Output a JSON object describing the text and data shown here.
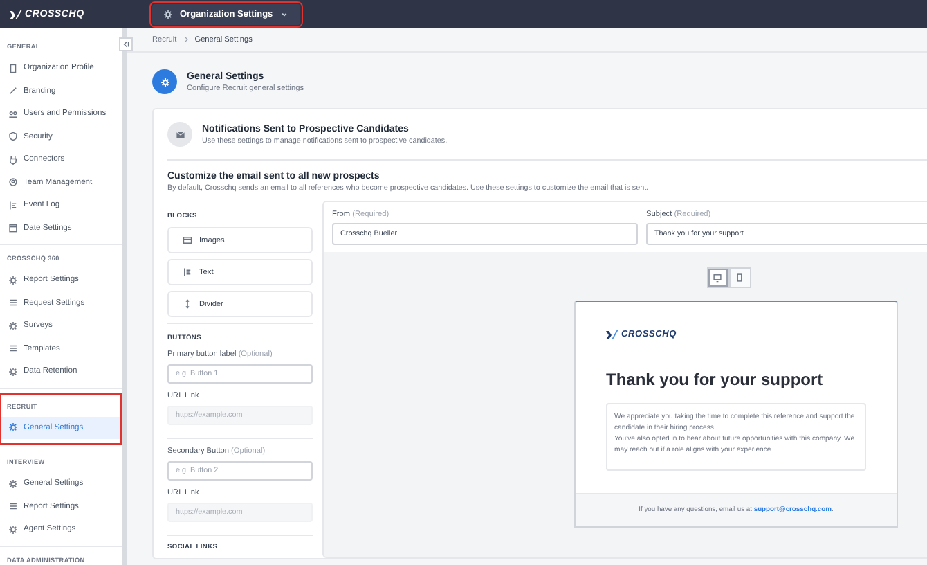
{
  "topbar": {
    "logo": "CROSSCHQ",
    "menu": {
      "label": "Organization Settings",
      "highlighted": true
    }
  },
  "sidebar": {
    "sections": [
      {
        "title": "GENERAL",
        "highlighted": false,
        "items": [
          {
            "label": "Organization Profile",
            "selected": false
          },
          {
            "label": "Branding",
            "selected": false
          },
          {
            "label": "Users and Permissions",
            "selected": false
          },
          {
            "label": "Security",
            "selected": false
          },
          {
            "label": "Connectors",
            "selected": false
          },
          {
            "label": "Team Management",
            "selected": false
          },
          {
            "label": "Event Log",
            "selected": false
          },
          {
            "label": "Date Settings",
            "selected": false
          }
        ]
      },
      {
        "title": "CROSSCHQ 360",
        "highlighted": false,
        "items": [
          {
            "label": "Report Settings",
            "selected": false
          },
          {
            "label": "Request Settings",
            "selected": false
          },
          {
            "label": "Surveys",
            "selected": false
          },
          {
            "label": "Templates",
            "selected": false
          },
          {
            "label": "Data Retention",
            "selected": false
          }
        ]
      },
      {
        "title": "RECRUIT",
        "highlighted": true,
        "items": [
          {
            "label": "General Settings",
            "selected": true
          }
        ]
      },
      {
        "title": "INTERVIEW",
        "highlighted": false,
        "items": [
          {
            "label": "General Settings",
            "selected": false
          },
          {
            "label": "Report Settings",
            "selected": false
          },
          {
            "label": "Agent Settings",
            "selected": false
          }
        ]
      },
      {
        "title": "DATA ADMINISTRATION",
        "highlighted": false
      }
    ]
  },
  "breadcrumb": [
    "Recruit",
    "General Settings"
  ],
  "page_header": {
    "title": "General Settings",
    "subtitle": "Configure Recruit general settings"
  },
  "notification": {
    "title": "Notifications Sent to Prospective Candidates",
    "description": "Use these settings to manage notifications sent to prospective candidates."
  },
  "customize": {
    "title": "Customize the email sent to all new prospects",
    "description": "By default, Crosschq sends an email to all references who become prospective candidates. Use these settings to customize the email that is sent."
  },
  "blocks": {
    "heading": "BLOCKS",
    "items": [
      "Images",
      "Text",
      "Divider"
    ]
  },
  "buttons_section": {
    "heading": "BUTTONS",
    "fields": [
      {
        "label": "Primary button label",
        "hint": "(Optional)",
        "placeholder": "e.g. Button 1",
        "disabled": false
      },
      {
        "label": "URL Link",
        "placeholder": "https://example.com",
        "disabled": true
      },
      {
        "label": "Secondary Button",
        "hint": "(Optional)",
        "placeholder": "e.g. Button 2",
        "disabled": false
      },
      {
        "label": "URL Link",
        "placeholder": "https://example.com",
        "disabled": true
      }
    ]
  },
  "social_links_heading": "SOCIAL LINKS",
  "email_fields": [
    {
      "label": "From",
      "hint": "(Required)",
      "value": "Crosschq Bueller"
    },
    {
      "label": "Subject",
      "hint": "(Required)",
      "value": "Thank you for your support"
    }
  ],
  "view_toggle": [
    {
      "kind": "desktop",
      "selected": true
    },
    {
      "kind": "mobile",
      "selected": false
    }
  ],
  "preview": {
    "logo": "CROSSCHQ",
    "heading": "Thank you for your support",
    "body": [
      "We appreciate you taking the time to complete this reference and support the candidate in their hiring process.",
      "You've also opted in to hear about future opportunities with this company. We may reach out if a role aligns with your experience."
    ],
    "footer_text": "If you have any questions, email us at",
    "footer_link": "support@crosschq.com",
    "footer_end": "."
  }
}
